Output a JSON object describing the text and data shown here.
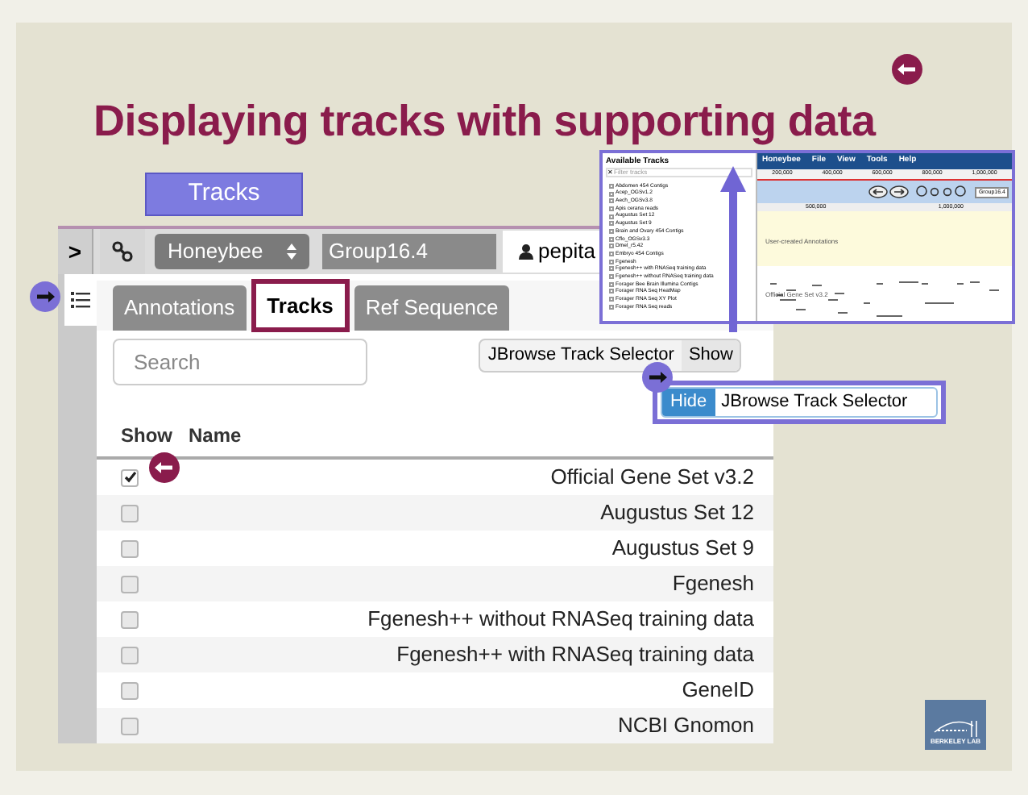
{
  "slide": {
    "title": "Displaying tracks with supporting data",
    "tracks_label": "Tracks"
  },
  "toolbar": {
    "expand": ">",
    "organism": "Honeybee",
    "sequence": "Group16.4",
    "user": "pepita"
  },
  "tabs": [
    {
      "label": "Annotations",
      "selected": false
    },
    {
      "label": "Tracks",
      "selected": true
    },
    {
      "label": "Ref Sequence",
      "selected": false
    }
  ],
  "search": {
    "placeholder": "Search"
  },
  "selector_toggle": {
    "label": "JBrowse Track Selector",
    "action": "Show",
    "active": false
  },
  "selector_toggle_after": {
    "action": "Hide",
    "label": "JBrowse Track Selector",
    "active": true
  },
  "table": {
    "columns": [
      "Show",
      "Name"
    ],
    "rows": [
      {
        "name": "Official Gene Set v3.2",
        "checked": true
      },
      {
        "name": "Augustus Set 12",
        "checked": false
      },
      {
        "name": "Augustus Set 9",
        "checked": false
      },
      {
        "name": "Fgenesh",
        "checked": false
      },
      {
        "name": "Fgenesh++ without RNASeq training data",
        "checked": false
      },
      {
        "name": "Fgenesh++ with RNASeq training data",
        "checked": false
      },
      {
        "name": "GeneID",
        "checked": false
      },
      {
        "name": "NCBI Gnomon",
        "checked": false
      }
    ]
  },
  "track_selector": {
    "title": "Available Tracks",
    "filter_placeholder": "Filter tracks",
    "clear": "✕",
    "tracks": [
      "Abdomen 454 Contigs",
      "Acep_OGSv1.2",
      "Aech_OGSv3.8",
      "Apis cerana reads",
      "Augustus Set 12",
      "Augustus Set 9",
      "Brain and Ovary 454 Contigs",
      "Cflo_OGSv3.3",
      "Dmel_r5.42",
      "Embryo 454 Contigs",
      "Fgenesh",
      "Fgenesh++ with RNASeq training data",
      "Fgenesh++ without RNASeq training data",
      "Forager Bee Brain Illumina Contigs",
      "Forager RNA Seq HeatMap",
      "Forager RNA Seq XY Plot",
      "Forager RNA Seq reads"
    ]
  },
  "jbrowse": {
    "menu": [
      "Honeybee",
      "File",
      "View",
      "Tools",
      "Help"
    ],
    "ruler": [
      "200,000",
      "400,000",
      "600,000",
      "800,000",
      "1,000,000"
    ],
    "location": "Group16.4",
    "scale": [
      "500,000",
      "1,000,000"
    ],
    "annotation_track": "User-created Annotations",
    "gene_track": "Official Gene Set v3.2"
  },
  "logo": {
    "text": "BERKELEY LAB"
  }
}
